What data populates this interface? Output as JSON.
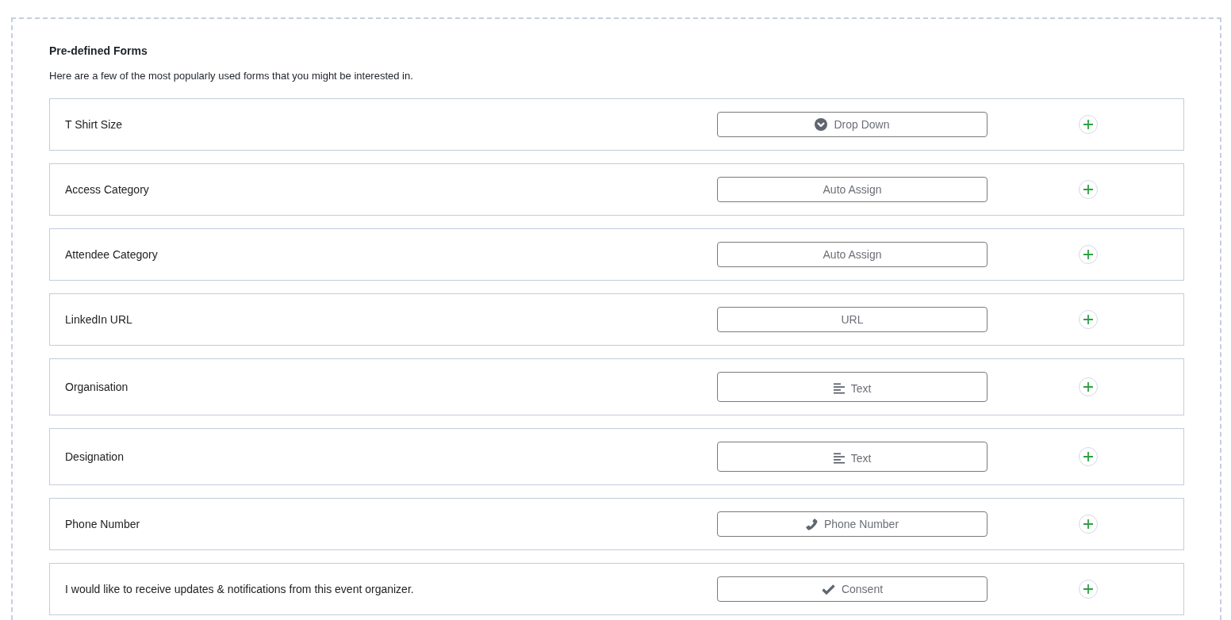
{
  "section": {
    "title": "Pre-defined Forms",
    "description": "Here are a few of the most popularly used forms that you might be interested in."
  },
  "forms": [
    {
      "label": "T Shirt Size",
      "field_type": {
        "kind": "dropdown",
        "label": "Drop Down"
      }
    },
    {
      "label": "Access Category",
      "field_type": {
        "kind": "auto",
        "label": "Auto Assign"
      }
    },
    {
      "label": "Attendee Category",
      "field_type": {
        "kind": "auto",
        "label": "Auto Assign"
      }
    },
    {
      "label": "LinkedIn URL",
      "field_type": {
        "kind": "url",
        "label": "URL"
      }
    },
    {
      "label": "Organisation",
      "field_type": {
        "kind": "text",
        "label": "Text"
      }
    },
    {
      "label": "Designation",
      "field_type": {
        "kind": "text",
        "label": "Text"
      }
    },
    {
      "label": "Phone Number",
      "field_type": {
        "kind": "phone",
        "label": "Phone Number"
      }
    },
    {
      "label": "I would like to receive updates & notifications from this event organizer.",
      "field_type": {
        "kind": "consent",
        "label": "Consent"
      }
    }
  ]
}
